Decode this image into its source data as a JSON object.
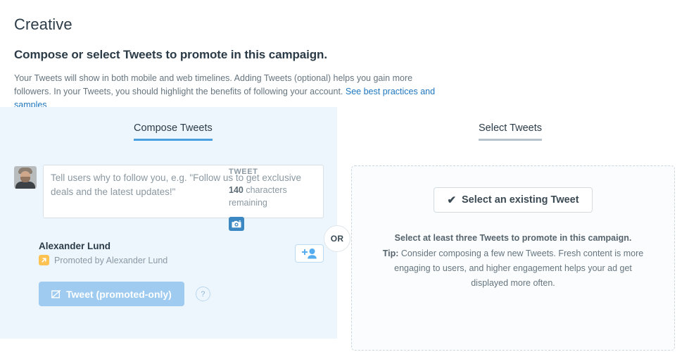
{
  "header": {
    "title": "Creative",
    "subtitle": "Compose or select Tweets to promote in this campaign.",
    "description": "Your Tweets will show in both mobile and web timelines. Adding Tweets (optional) helps you gain more followers. In your Tweets, you should highlight the benefits of following your account.",
    "link_text": "See best practices and samples"
  },
  "tabs": {
    "compose": "Compose Tweets",
    "select": "Select Tweets",
    "divider_badge": "OR"
  },
  "compose": {
    "placeholder": "Tell users why to follow you, e.g. \"Follow us to get exclusive deals and the latest updates!\"",
    "value": "",
    "meta_label": "TWEET",
    "count": "140",
    "count_suffix": " characters remaining",
    "camera_icon": "camera-icon",
    "user_name": "Alexander Lund",
    "promoted_text": "Promoted by Alexander Lund",
    "promoted_icon": "promoted-arrow-icon",
    "follow_icon": "add-user-icon",
    "tweet_button": "Tweet (promoted-only)",
    "tweet_button_icon": "compose-icon",
    "help_icon": "?"
  },
  "select_panel": {
    "button_label": "Select an existing Tweet",
    "button_icon": "check-icon",
    "headline": "Select at least three Tweets to promote in this campaign.",
    "tip_label": "Tip:",
    "tip_text": " Consider composing a few new Tweets. Fresh content is more engaging to users, and higher engagement helps your ad get displayed more often."
  },
  "colors": {
    "panel_blue": "#eef6fd",
    "accent_blue": "#4a9fe0",
    "link_blue": "#2077bf",
    "promoted_amber": "#fcc352",
    "disabled_button": "#9ecbef"
  }
}
